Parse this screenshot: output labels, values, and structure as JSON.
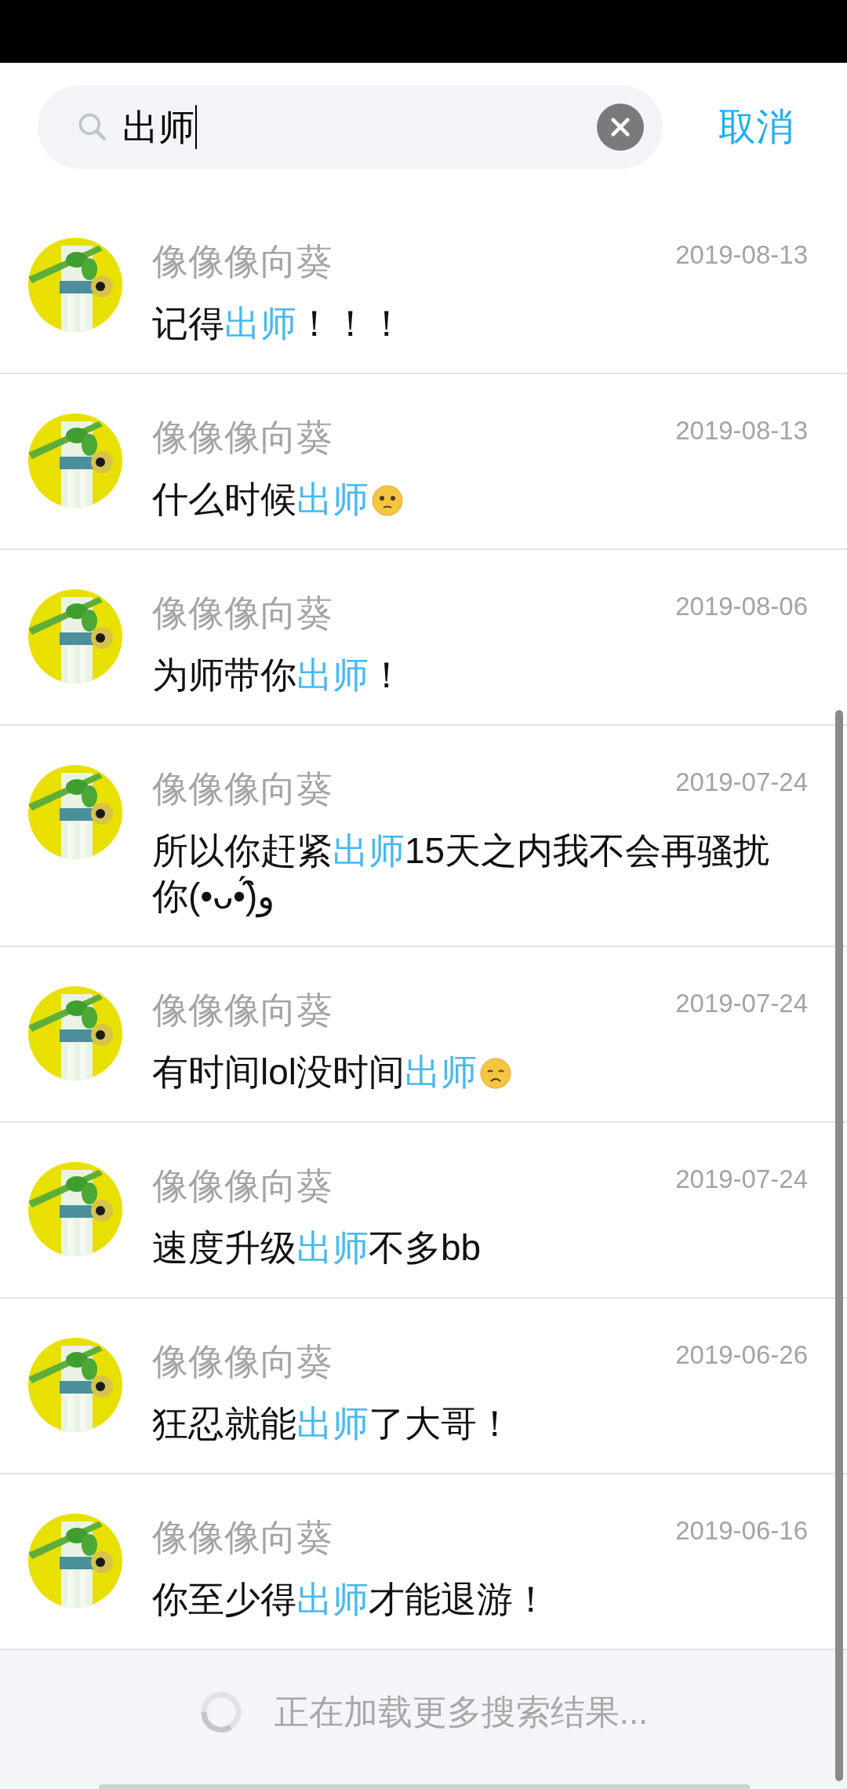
{
  "search": {
    "value": "出师",
    "cancel": "取消"
  },
  "results": [
    {
      "name": "像像像向葵",
      "date": "2019-08-13",
      "message": [
        {
          "kind": "text",
          "text": "记得"
        },
        {
          "kind": "highlight",
          "text": "出师"
        },
        {
          "kind": "text",
          "text": "！！！"
        }
      ]
    },
    {
      "name": "像像像向葵",
      "date": "2019-08-13",
      "message": [
        {
          "kind": "text",
          "text": "什么时候"
        },
        {
          "kind": "highlight",
          "text": "出师"
        },
        {
          "kind": "puzzled-emoji"
        }
      ]
    },
    {
      "name": "像像像向葵",
      "date": "2019-08-06",
      "message": [
        {
          "kind": "text",
          "text": "为师带你"
        },
        {
          "kind": "highlight",
          "text": "出师"
        },
        {
          "kind": "text",
          "text": "！"
        }
      ]
    },
    {
      "name": "像像像向葵",
      "date": "2019-07-24",
      "message": [
        {
          "kind": "text",
          "text": "所以你赶紧"
        },
        {
          "kind": "highlight",
          "text": "出师"
        },
        {
          "kind": "text",
          "text": "15天之内我不会再骚扰你(•ᴗ•́)و̑̑"
        }
      ]
    },
    {
      "name": "像像像向葵",
      "date": "2019-07-24",
      "message": [
        {
          "kind": "text",
          "text": "有时间lol没时间"
        },
        {
          "kind": "highlight",
          "text": "出师"
        },
        {
          "kind": "sad-emoji"
        }
      ]
    },
    {
      "name": "像像像向葵",
      "date": "2019-07-24",
      "message": [
        {
          "kind": "text",
          "text": "速度升级"
        },
        {
          "kind": "highlight",
          "text": "出师"
        },
        {
          "kind": "text",
          "text": "不多bb"
        }
      ]
    },
    {
      "name": "像像像向葵",
      "date": "2019-06-26",
      "message": [
        {
          "kind": "text",
          "text": "狂忍就能"
        },
        {
          "kind": "highlight",
          "text": "出师"
        },
        {
          "kind": "text",
          "text": "了大哥！"
        }
      ]
    },
    {
      "name": "像像像向葵",
      "date": "2019-06-16",
      "message": [
        {
          "kind": "text",
          "text": "你至少得"
        },
        {
          "kind": "highlight",
          "text": "出师"
        },
        {
          "kind": "text",
          "text": "才能退游！"
        }
      ]
    }
  ],
  "footer": {
    "loading": "正在加载更多搜索结果..."
  }
}
